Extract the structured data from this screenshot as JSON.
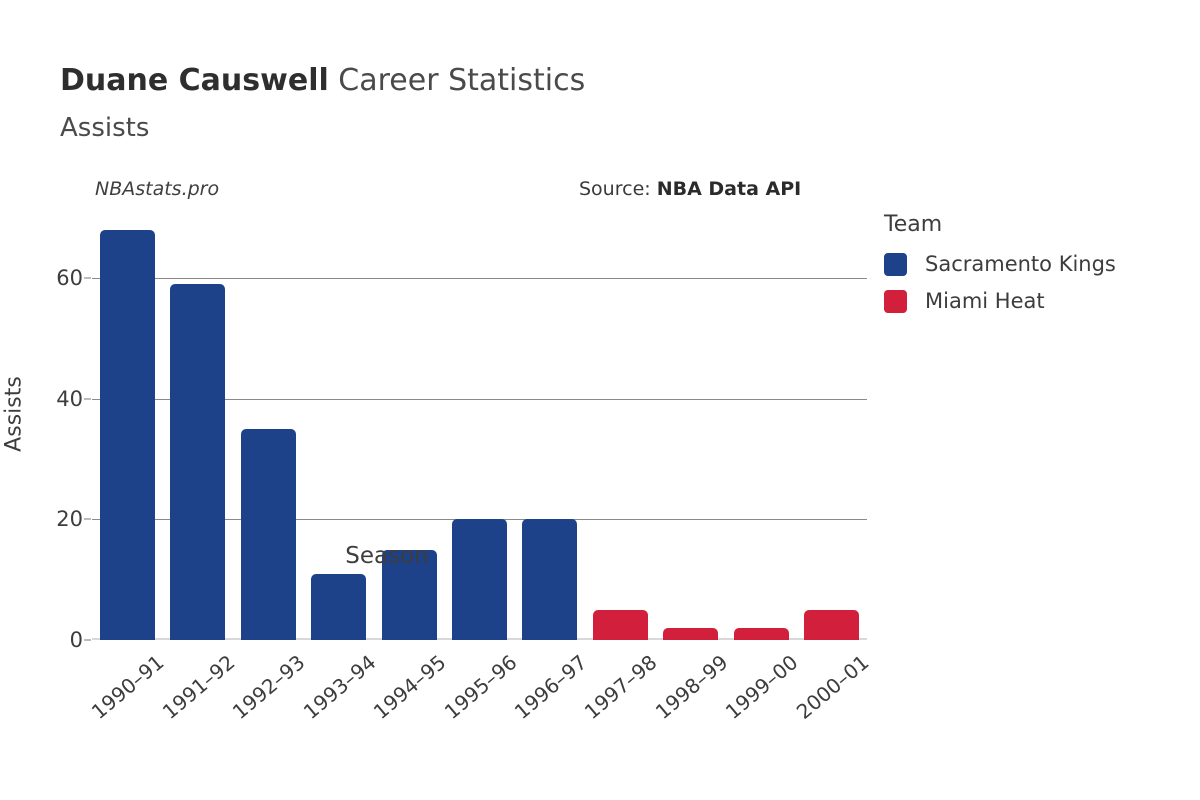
{
  "header": {
    "title_strong": "Duane Causwell",
    "title_rest": " Career Statistics",
    "subtitle": "Assists",
    "watermark": "NBAstats.pro",
    "source_prefix": "Source: ",
    "source_value": "NBA Data API"
  },
  "legend": {
    "title": "Team",
    "items": [
      {
        "label": "Sacramento Kings",
        "color": "#1d4289"
      },
      {
        "label": "Miami Heat",
        "color": "#d21f3c"
      }
    ]
  },
  "colors": {
    "kings_blue": "#1d4289",
    "heat_red": "#d21f3c",
    "gridline": "#8a8a8a",
    "text": "#3d3d3d"
  },
  "chart_data": {
    "type": "bar",
    "title": "Duane Causwell Career Statistics",
    "subtitle": "Assists",
    "xlabel": "Season",
    "ylabel": "Assists",
    "ylim": [
      0,
      70
    ],
    "yticks": [
      0,
      20,
      40,
      60
    ],
    "ytick_labels": [
      "0",
      "20",
      "40",
      "60"
    ],
    "grid": true,
    "legend_position": "right",
    "categories": [
      "1990–91",
      "1991–92",
      "1992–93",
      "1993–94",
      "1994–95",
      "1995–96",
      "1996–97",
      "1997–98",
      "1998–99",
      "1999–00",
      "2000–01"
    ],
    "values": [
      68,
      59,
      35,
      11,
      15,
      20,
      20,
      5,
      2,
      2,
      5
    ],
    "point_teams": [
      "Sacramento Kings",
      "Sacramento Kings",
      "Sacramento Kings",
      "Sacramento Kings",
      "Sacramento Kings",
      "Sacramento Kings",
      "Sacramento Kings",
      "Miami Heat",
      "Miami Heat",
      "Miami Heat",
      "Miami Heat"
    ],
    "series": [
      {
        "name": "Sacramento Kings",
        "color": "#1d4289",
        "categories": [
          "1990–91",
          "1991–92",
          "1992–93",
          "1993–94",
          "1994–95",
          "1995–96",
          "1996–97"
        ],
        "values": [
          68,
          59,
          35,
          11,
          15,
          20,
          20
        ]
      },
      {
        "name": "Miami Heat",
        "color": "#d21f3c",
        "categories": [
          "1997–98",
          "1998–99",
          "1999–00",
          "2000–01"
        ],
        "values": [
          5,
          2,
          2,
          5
        ]
      }
    ]
  }
}
